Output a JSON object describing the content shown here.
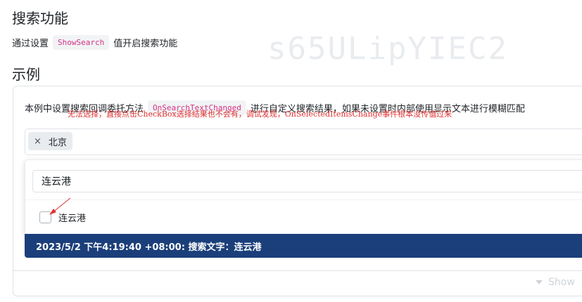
{
  "page": {
    "title": "搜索功能",
    "intro_prefix": "通过设置",
    "intro_code": "ShowSearch",
    "intro_suffix": "值开启搜索功能",
    "example_title": "示例",
    "watermark": "s65ULipYIEC2",
    "watermark_fragment": "2"
  },
  "example": {
    "desc_prefix": "本例中设置搜索回调委托方法",
    "desc_code": "OnSearchTextChanged",
    "desc_suffix": "进行自定义搜索结果，如果未设置时内部使用显示文本进行模糊匹配",
    "selected_tag": {
      "remove_glyph": "×",
      "label": "北京"
    },
    "search_value": "连云港",
    "option_label": "连云港",
    "option_checked": false,
    "annotation": "无法选择，直接点击CheckBox选择结果也不会有，调试发现，OnSelectedItemsChange事件根本没传值过来",
    "log": "2023/5/2 下午4:19:40 +08:00: 搜索文字：连云港",
    "show_label": "Show"
  },
  "colors": {
    "accent": "#1b3f7a",
    "annotation": "#e03131",
    "code": "#d63384"
  }
}
